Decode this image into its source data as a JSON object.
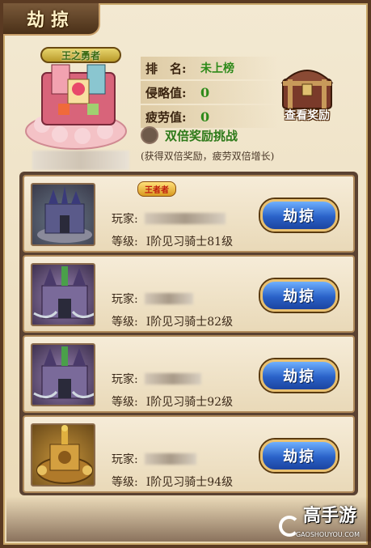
{
  "title": "劫掠",
  "header": {
    "emblem_text": "王之勇者",
    "stats": [
      {
        "label": "排　名:",
        "value": "未上榜"
      },
      {
        "label": "侵略值:",
        "value": "0"
      },
      {
        "label": "疲劳值:",
        "value": "0"
      }
    ],
    "reward_label": "查看奖励",
    "double_label": "双倍奖励挑战",
    "double_note": "(获得双倍奖励，疲劳双倍增长)"
  },
  "list": {
    "player_label": "玩家:",
    "level_label": "等级:",
    "button_label": "劫掠",
    "king_badge": "王者者",
    "cards": [
      {
        "level": "I阶见习骑士81级",
        "thumb": "silver",
        "badge": true
      },
      {
        "level": "I阶见习骑士82级",
        "thumb": "purple",
        "badge": false
      },
      {
        "level": "I阶见习骑士92级",
        "thumb": "purple",
        "badge": false
      },
      {
        "level": "I阶见习骑士94级",
        "thumb": "gold",
        "badge": false
      }
    ]
  },
  "watermark": {
    "title": "高手游",
    "url": "GAOSHOUYOU.COM"
  },
  "colors": {
    "accent_green": "#2e8a1a",
    "button_blue": "#2a62c8",
    "frame_brown": "#5a3a22"
  }
}
